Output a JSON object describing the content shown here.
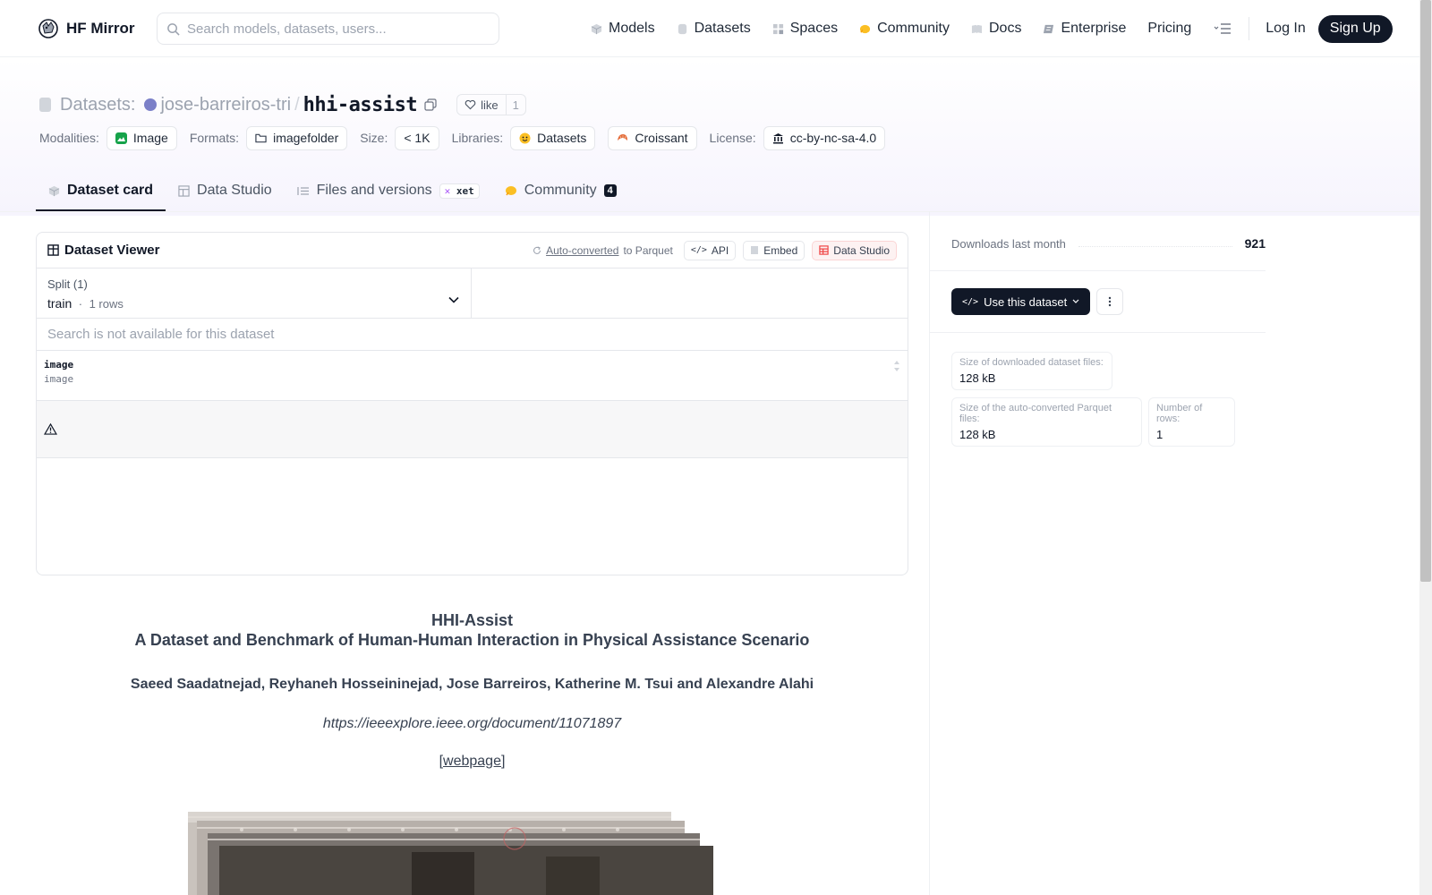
{
  "nav": {
    "brand": "HF Mirror",
    "search_placeholder": "Search models, datasets, users...",
    "links": [
      {
        "label": "Models",
        "icon": "models-icon"
      },
      {
        "label": "Datasets",
        "icon": "datasets-icon"
      },
      {
        "label": "Spaces",
        "icon": "spaces-icon"
      },
      {
        "label": "Community",
        "icon": "community-icon"
      },
      {
        "label": "Docs",
        "icon": "docs-icon"
      },
      {
        "label": "Enterprise",
        "icon": "enterprise-icon"
      },
      {
        "label": "Pricing",
        "icon": ""
      }
    ],
    "login": "Log In",
    "signup": "Sign Up"
  },
  "header": {
    "section_label": "Datasets:",
    "owner": "jose-barreiros-tri",
    "repo": "hhi-assist",
    "like_label": "like",
    "like_count": "1",
    "tags": [
      {
        "group": "Modalities:",
        "items": [
          {
            "label": "Image",
            "color": "#16a34a"
          }
        ]
      },
      {
        "group": "Formats:",
        "items": [
          {
            "label": "imagefolder",
            "color": "#374151"
          }
        ]
      },
      {
        "group": "Size:",
        "items": [
          {
            "label": "< 1K",
            "color": ""
          }
        ]
      },
      {
        "group": "Libraries:",
        "items": [
          {
            "label": "Datasets",
            "color": "#f59e0b"
          },
          {
            "label": "Croissant",
            "color": "#e46c3a"
          }
        ]
      },
      {
        "group": "License:",
        "items": [
          {
            "label": "cc-by-nc-sa-4.0",
            "color": "#111827"
          }
        ]
      }
    ]
  },
  "tabs": [
    {
      "label": "Dataset card",
      "active": true
    },
    {
      "label": "Data Studio",
      "active": false
    },
    {
      "label": "Files and versions",
      "badge": "xet",
      "active": false
    },
    {
      "label": "Community",
      "count": "4",
      "active": false
    }
  ],
  "viewer": {
    "title": "Dataset Viewer",
    "auto_converted": "Auto-converted",
    "to_parquet": "to Parquet",
    "api": "API",
    "embed": "Embed",
    "data_studio": "Data Studio",
    "split_label": "Split (1)",
    "split_value": "train",
    "split_rows": "1 rows",
    "search_na": "Search is not available for this dataset",
    "column_name": "image",
    "column_type": "image"
  },
  "card": {
    "title": "HHI-Assist",
    "subtitle": "A Dataset and Benchmark of Human-Human Interaction in Physical Assistance Scenario",
    "authors": "Saeed Saadatnejad, Reyhaneh Hosseininejad, Jose Barreiros, Katherine M. Tsui and Alexandre Alahi",
    "paper_link": "https://ieeexplore.ieee.org/document/11071897",
    "webpage_link": "webpage"
  },
  "sidebar": {
    "downloads_label": "Downloads last month",
    "downloads_value": "921",
    "use_dataset": "Use this dataset",
    "size_downloaded_label": "Size of downloaded dataset files:",
    "size_downloaded_value": "128 kB",
    "size_parquet_label": "Size of the auto-converted Parquet files:",
    "size_parquet_value": "128 kB",
    "num_rows_label": "Number of rows:",
    "num_rows_value": "1"
  }
}
